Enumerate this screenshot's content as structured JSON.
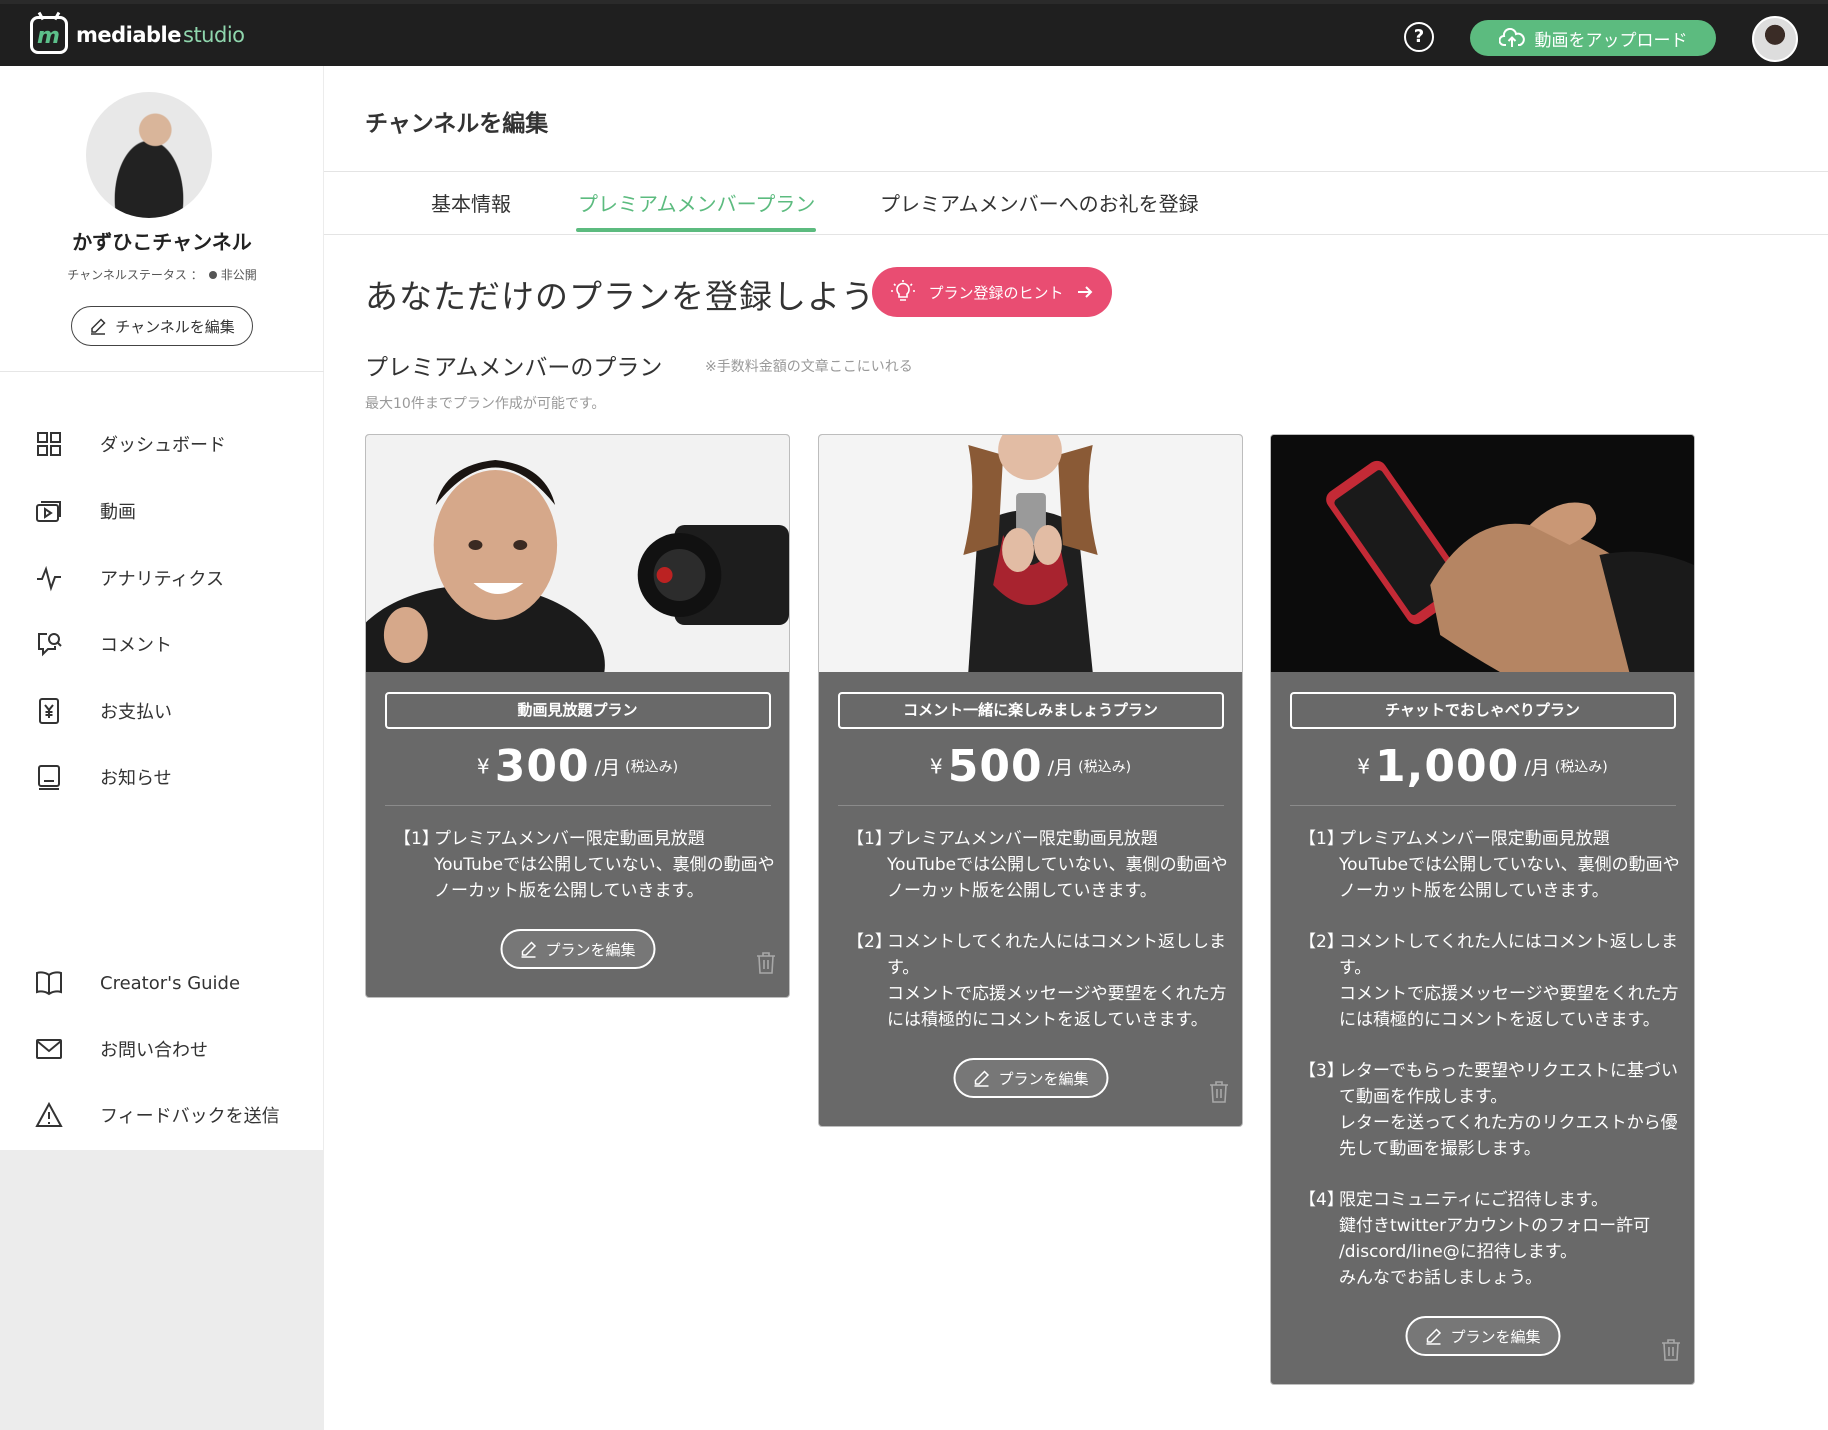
{
  "topbar": {
    "logo_brand": "mediable",
    "logo_product": "studio",
    "upload_label": "動画をアップロード"
  },
  "sidebar": {
    "channel_name": "かずひこチャンネル",
    "channel_status_label": "チャンネルステータス ：",
    "channel_status_value": "非公開",
    "edit_channel_label": "チャンネルを編集",
    "nav": [
      {
        "label": "ダッシュボード",
        "icon": "grid-icon"
      },
      {
        "label": "動画",
        "icon": "video-icon"
      },
      {
        "label": "アナリティクス",
        "icon": "pulse-icon"
      },
      {
        "label": "コメント",
        "icon": "comment-icon"
      },
      {
        "label": "お支払い",
        "icon": "yen-icon"
      },
      {
        "label": "お知らせ",
        "icon": "notice-icon"
      }
    ],
    "footer_nav": [
      {
        "label": "Creator's Guide",
        "icon": "book-icon"
      },
      {
        "label": "お問い合わせ",
        "icon": "mail-icon"
      },
      {
        "label": "フィードバックを送信",
        "icon": "warning-icon"
      }
    ]
  },
  "main": {
    "title": "チャンネルを編集",
    "tabs": [
      {
        "label": "基本情報",
        "active": false
      },
      {
        "label": "プレミアムメンバープラン",
        "active": true
      },
      {
        "label": "プレミアムメンバーへのお礼を登録",
        "active": false
      }
    ],
    "headline": "あなただけのプランを登録しよう",
    "hint_label": "プラン登録のヒント",
    "section_title": "プレミアムメンバーのプラン",
    "section_note": "※手数料金額の文章ここにいれる",
    "sub_note": "最大10件までプラン作成が可能です。",
    "edit_plan_label": "プランを編集",
    "plans": [
      {
        "name": "動画見放題プラン",
        "currency": "¥",
        "price": "300",
        "unit": "/月",
        "tax": "(税込み)",
        "benefits": [
          {
            "num": "【1】",
            "text": "プレミアムメンバー限定動画見放題\nYouTubeでは公開していない、裏側の動画やノーカット版を公開していきます。"
          }
        ]
      },
      {
        "name": "コメント一緒に楽しみましょうプラン",
        "currency": "¥",
        "price": "500",
        "unit": "/月",
        "tax": "(税込み)",
        "benefits": [
          {
            "num": "【1】",
            "text": "プレミアムメンバー限定動画見放題\nYouTubeでは公開していない、裏側の動画やノーカット版を公開していきます。"
          },
          {
            "num": "【2】",
            "text": "コメントしてくれた人にはコメント返しします。\nコメントで応援メッセージや要望をくれた方には積極的にコメントを返していきます。"
          }
        ]
      },
      {
        "name": "チャットでおしゃべりプラン",
        "currency": "¥",
        "price": "1,000",
        "unit": "/月",
        "tax": "(税込み)",
        "benefits": [
          {
            "num": "【1】",
            "text": "プレミアムメンバー限定動画見放題\nYouTubeでは公開していない、裏側の動画やノーカット版を公開していきます。"
          },
          {
            "num": "【2】",
            "text": "コメントしてくれた人にはコメント返しします。\nコメントで応援メッセージや要望をくれた方には積極的にコメントを返していきます。"
          },
          {
            "num": "【3】",
            "text": "レターでもらった要望やリクエストに基づいて動画を作成します。\nレターを送ってくれた方のリクエストから優先して動画を撮影します。"
          },
          {
            "num": "【4】",
            "text": "限定コミュニティにご招待します。\n鍵付きtwitterアカウントのフォロー許可 /discord/line@に招待します。\nみんなでお話しましょう。"
          }
        ]
      }
    ]
  }
}
